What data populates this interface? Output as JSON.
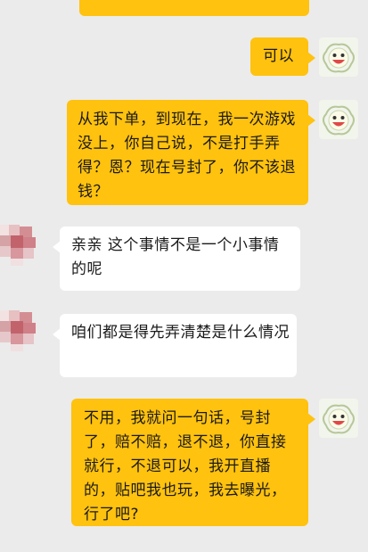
{
  "chat": {
    "messages": [
      {
        "sender": "self",
        "text": ""
      },
      {
        "sender": "self",
        "text": "可以"
      },
      {
        "sender": "self",
        "text": "从我下单，到现在，我一次游戏没上，你自己说，不是打手弄得？恩？现在号封了，你不该退钱？"
      },
      {
        "sender": "other",
        "text": "亲亲 这个事情不是一个小事情的呢"
      },
      {
        "sender": "other",
        "text": "咱们都是得先弄清楚是什么情况"
      },
      {
        "sender": "self",
        "text": "不用，我就问一句话，号封了，赔不赔，退不退，你直接就行，不退可以，我开直播的，贴吧我也玩，我去曝光，行了吧?"
      }
    ]
  },
  "colors": {
    "background": "#ebebeb",
    "self_bubble": "#ffc20e",
    "other_bubble": "#ffffff"
  },
  "avatars": {
    "self_icon": "cartoon-smiley-avatar-icon",
    "other_icon": "pixelated-avatar-icon"
  }
}
